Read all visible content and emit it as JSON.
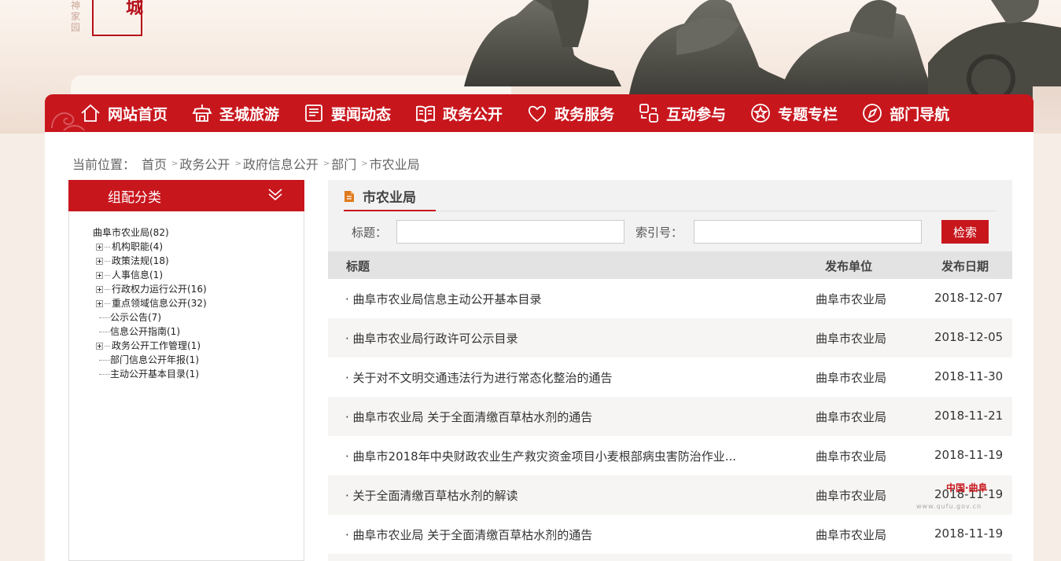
{
  "header": {
    "logo_vertical_text": "神家园",
    "logo_char": "城"
  },
  "nav": {
    "items": [
      {
        "label": "网站首页",
        "icon": "home-icon"
      },
      {
        "label": "圣城旅游",
        "icon": "temple-icon"
      },
      {
        "label": "要闻动态",
        "icon": "news-icon"
      },
      {
        "label": "政务公开",
        "icon": "book-icon"
      },
      {
        "label": "政务服务",
        "icon": "heart-hand-icon"
      },
      {
        "label": "互动参与",
        "icon": "interaction-icon"
      },
      {
        "label": "专题专栏",
        "icon": "star-icon"
      },
      {
        "label": "部门导航",
        "icon": "compass-icon"
      }
    ]
  },
  "breadcrumb": {
    "prefix": "当前位置：",
    "items": [
      "首页",
      "政务公开",
      "政府信息公开",
      "部门",
      "市农业局"
    ]
  },
  "sidebar": {
    "title": "组配分类",
    "tree": {
      "root": "曲阜市农业局(82)",
      "children": [
        {
          "label": "机构职能(4)",
          "expandable": true
        },
        {
          "label": "政策法规(18)",
          "expandable": true
        },
        {
          "label": "人事信息(1)",
          "expandable": true
        },
        {
          "label": "行政权力运行公开(16)",
          "expandable": true
        },
        {
          "label": "重点领域信息公开(32)",
          "expandable": true
        },
        {
          "label": "公示公告(7)",
          "expandable": false
        },
        {
          "label": "信息公开指南(1)",
          "expandable": false
        },
        {
          "label": "政务公开工作管理(1)",
          "expandable": true
        },
        {
          "label": "部门信息公开年报(1)",
          "expandable": false
        },
        {
          "label": "主动公开基本目录(1)",
          "expandable": false
        }
      ]
    }
  },
  "content": {
    "title": "市农业局",
    "search": {
      "title_label": "标题：",
      "title_value": "",
      "index_label": "索引号：",
      "index_value": "",
      "button": "检索"
    },
    "table": {
      "headers": [
        "标题",
        "发布单位",
        "发布日期"
      ],
      "rows": [
        {
          "title": "· 曲阜市农业局信息主动公开基本目录",
          "unit": "曲阜市农业局",
          "date": "2018-12-07"
        },
        {
          "title": "· 曲阜市农业局行政许可公示目录",
          "unit": "曲阜市农业局",
          "date": "2018-12-05"
        },
        {
          "title": "· 关于对不文明交通违法行为进行常态化整治的通告",
          "unit": "曲阜市农业局",
          "date": "2018-11-30"
        },
        {
          "title": "· 曲阜市农业局 关于全面清缴百草枯水剂的通告",
          "unit": "曲阜市农业局",
          "date": "2018-11-21"
        },
        {
          "title": "· 曲阜市2018年中央财政农业生产救灾资金项目小麦根部病虫害防治作业...",
          "unit": "曲阜市农业局",
          "date": "2018-11-19"
        },
        {
          "title": "· 关于全面清缴百草枯水剂的解读",
          "unit": "曲阜市农业局",
          "date": "2018-11-19"
        },
        {
          "title": "· 曲阜市农业局 关于全面清缴百草枯水剂的通告",
          "unit": "曲阜市农业局",
          "date": "2018-11-19"
        }
      ]
    }
  },
  "watermark": {
    "text": "中国·曲阜",
    "url_text": "www.qufu.gov.cn"
  },
  "colors": {
    "brand_red": "#c8161d",
    "header_bg": "#f4e7dd",
    "row_alt": "#f7f5f3"
  }
}
